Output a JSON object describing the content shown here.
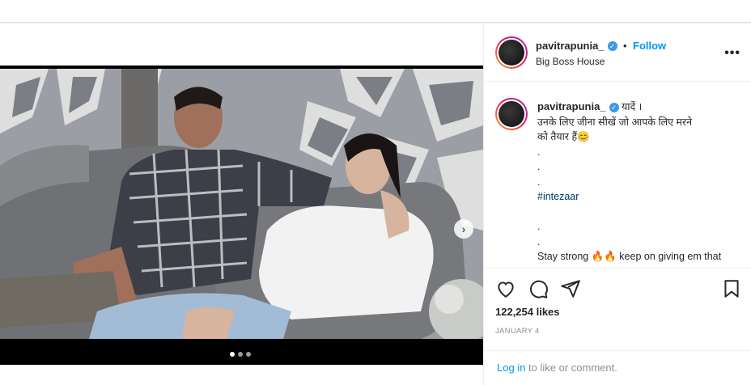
{
  "post": {
    "author": {
      "username": "pavitrapunia_",
      "verified_icon": "verified-badge-icon",
      "follow_label": "Follow",
      "separator": "•",
      "location": "Big Boss House"
    },
    "more_label": "•••",
    "media": {
      "description_icon": "photo-carousel",
      "next_label": "›",
      "slide_count": 3,
      "active_slide": 1
    },
    "caption": {
      "username": "pavitrapunia_",
      "lines": [
        "यादें ।",
        "उनके लिए जीना सीखें जो आपके लिए मरने",
        "को तैयार हैं😊",
        ".",
        ".",
        ".",
        "#intezaar",
        "",
        ".",
        ".",
        "Stay strong 🔥🔥 keep on giving em that"
      ]
    },
    "actions": {
      "like_icon": "heart-icon",
      "comment_icon": "comment-icon",
      "share_icon": "share-icon",
      "save_icon": "bookmark-icon"
    },
    "likes": "122,254 likes",
    "date": "JANUARY 4",
    "login": {
      "link": "Log in",
      "text": " to like or comment."
    }
  }
}
